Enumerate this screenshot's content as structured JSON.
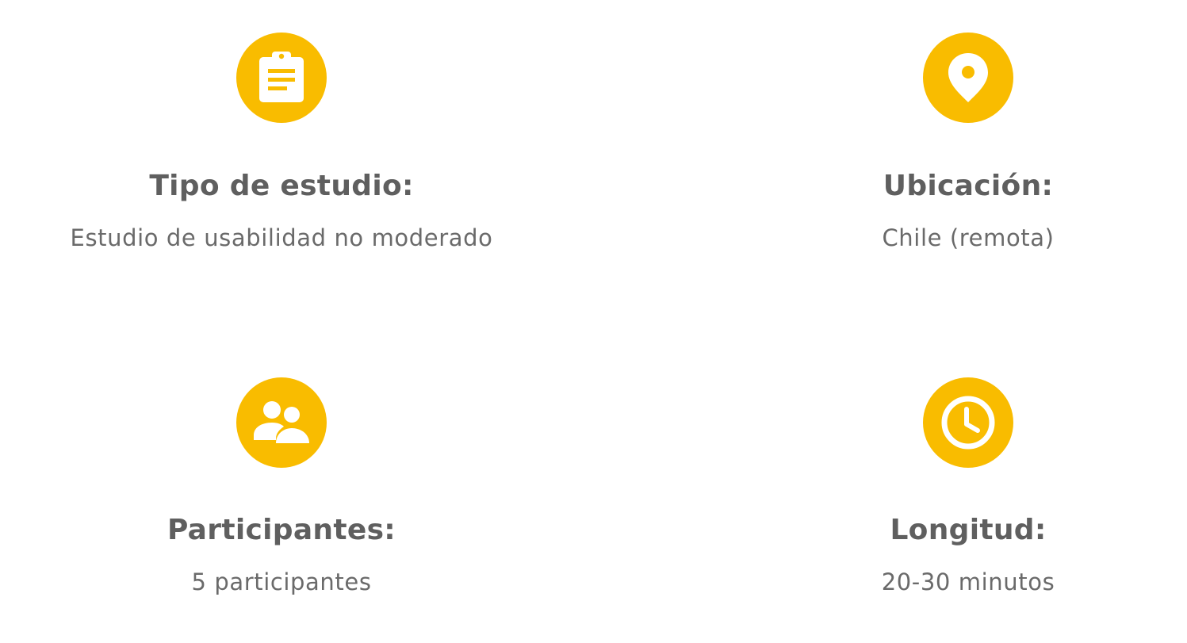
{
  "colors": {
    "accent": "#F9BC00",
    "title_text": "#5f5f5f",
    "value_text": "#6a6a6a"
  },
  "items": [
    {
      "icon": "clipboard-icon",
      "title": "Tipo de estudio:",
      "value": "Estudio de usabilidad no moderado"
    },
    {
      "icon": "location-pin-icon",
      "title": "Ubicación:",
      "value": "Chile (remota)"
    },
    {
      "icon": "people-icon",
      "title": "Participantes:",
      "value": "5 participantes"
    },
    {
      "icon": "clock-icon",
      "title": "Longitud:",
      "value": "20-30 minutos"
    }
  ]
}
